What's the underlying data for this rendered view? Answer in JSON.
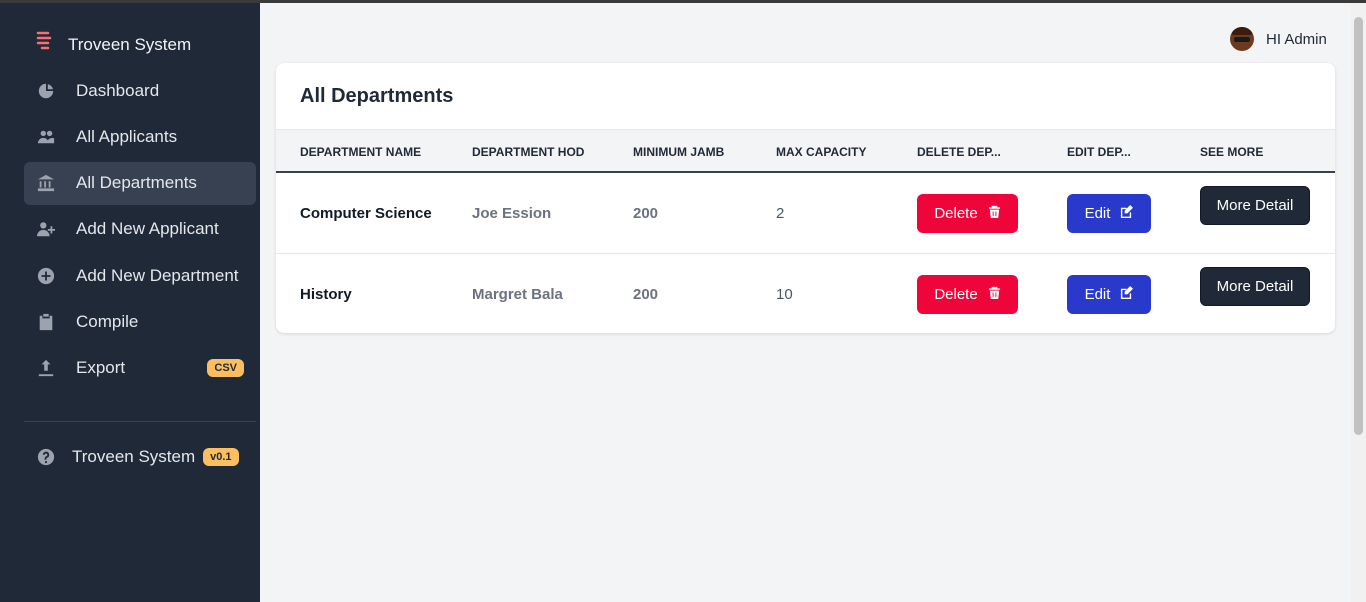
{
  "colors": {
    "sidebar": "#1f2937",
    "active": "#374151",
    "badge": "#fbbf60",
    "delete": "#f0053a",
    "edit": "#2939cc",
    "more": "#1f2937"
  },
  "brand": {
    "name": "Troveen System",
    "icon": "brand-logo-icon"
  },
  "nav": [
    {
      "label": "Dashboard",
      "icon": "chart-pie-icon"
    },
    {
      "label": "All Applicants",
      "icon": "users-icon"
    },
    {
      "label": "All Departments",
      "icon": "building-icon",
      "active": true
    },
    {
      "label": "Add New Applicant",
      "icon": "user-add-icon"
    },
    {
      "label": "Add New Department",
      "icon": "plus-circle-icon"
    },
    {
      "label": "Compile",
      "icon": "clipboard-icon"
    },
    {
      "label": "Export",
      "icon": "upload-icon",
      "badge": "CSV"
    }
  ],
  "footer": {
    "label": "Troveen System",
    "badge": "v0.1",
    "icon": "question-circle-icon"
  },
  "user": {
    "greeting": "HI Admin"
  },
  "card": {
    "title": "All Departments",
    "columns": [
      "Department Name",
      "Department HOD",
      "Minimum Jamb",
      "Max Capacity",
      "Delete Dep...",
      "Edit Dep...",
      "See More"
    ],
    "rows": [
      {
        "name": "Computer Science",
        "hod": "Joe Ession",
        "jamb": "200",
        "capacity": "2"
      },
      {
        "name": "History",
        "hod": "Margret Bala",
        "jamb": "200",
        "capacity": "10"
      }
    ],
    "delete_label": "Delete",
    "edit_label": "Edit",
    "more_label": "More Detail"
  }
}
